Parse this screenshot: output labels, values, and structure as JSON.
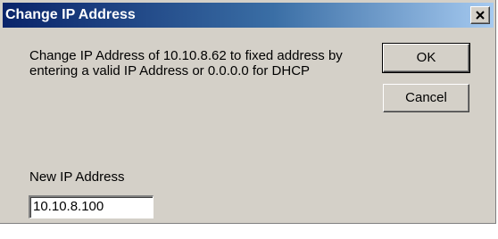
{
  "window": {
    "title": "Change IP Address",
    "close_icon": "close-icon",
    "title_gradient": [
      "#0a246a",
      "#a6caf0"
    ],
    "background": "#d4d0c8"
  },
  "message": "Change IP Address of 10.10.8.62 to fixed address by\nentering a valid IP Address or 0.0.0.0 for DHCP",
  "buttons": {
    "ok_label": "OK",
    "cancel_label": "Cancel"
  },
  "ip_field": {
    "label": "New IP Address",
    "value": "10.10.8.100"
  }
}
